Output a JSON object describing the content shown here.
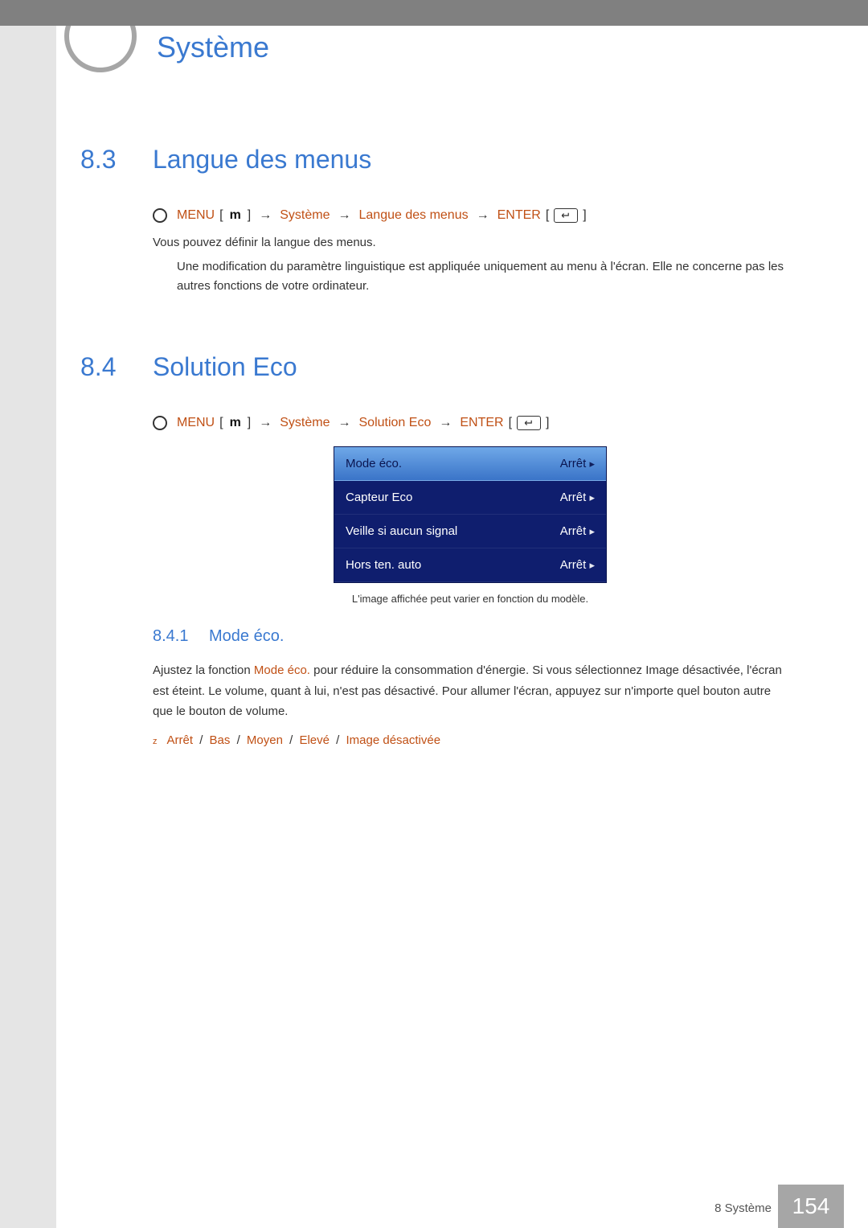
{
  "header": {
    "chapter_title": "Système"
  },
  "sections": {
    "s83": {
      "num": "8.3",
      "title": "Langue des menus",
      "nav": {
        "menu_label": "MENU",
        "menu_glyph": "m",
        "system": "Système",
        "path_item": "Langue des menus",
        "enter_label": "ENTER"
      },
      "desc": "Vous pouvez définir la langue des menus.",
      "note": "Une modification du paramètre linguistique est appliquée uniquement au menu à l'écran. Elle ne concerne pas les autres fonctions de votre ordinateur."
    },
    "s84": {
      "num": "8.4",
      "title": "Solution Eco",
      "nav": {
        "menu_label": "MENU",
        "menu_glyph": "m",
        "system": "Système",
        "path_item": "Solution Eco",
        "enter_label": "ENTER"
      },
      "menu_items": [
        {
          "label": "Mode éco.",
          "value": "Arrêt"
        },
        {
          "label": "Capteur Eco",
          "value": "Arrêt"
        },
        {
          "label": "Veille si aucun signal",
          "value": "Arrêt"
        },
        {
          "label": "Hors ten. auto",
          "value": "Arrêt"
        }
      ],
      "menu_caption": "L'image affichée peut varier en fonction du modèle.",
      "sub": {
        "num": "8.4.1",
        "title": "Mode éco.",
        "para_pre": "Ajustez la fonction ",
        "para_hl": "Mode éco.",
        "para_post": " pour réduire la consommation d'énergie. Si vous sélectionnez Image désactivée, l'écran est éteint. Le volume, quant à lui, n'est pas désactivé. Pour allumer l'écran, appuyez sur n'importe quel bouton autre que le bouton de volume.",
        "options": [
          "Arrêt",
          "Bas",
          "Moyen",
          "Elevé",
          "Image désactivée"
        ]
      }
    }
  },
  "footer": {
    "label": "8 Système",
    "page": "154"
  }
}
